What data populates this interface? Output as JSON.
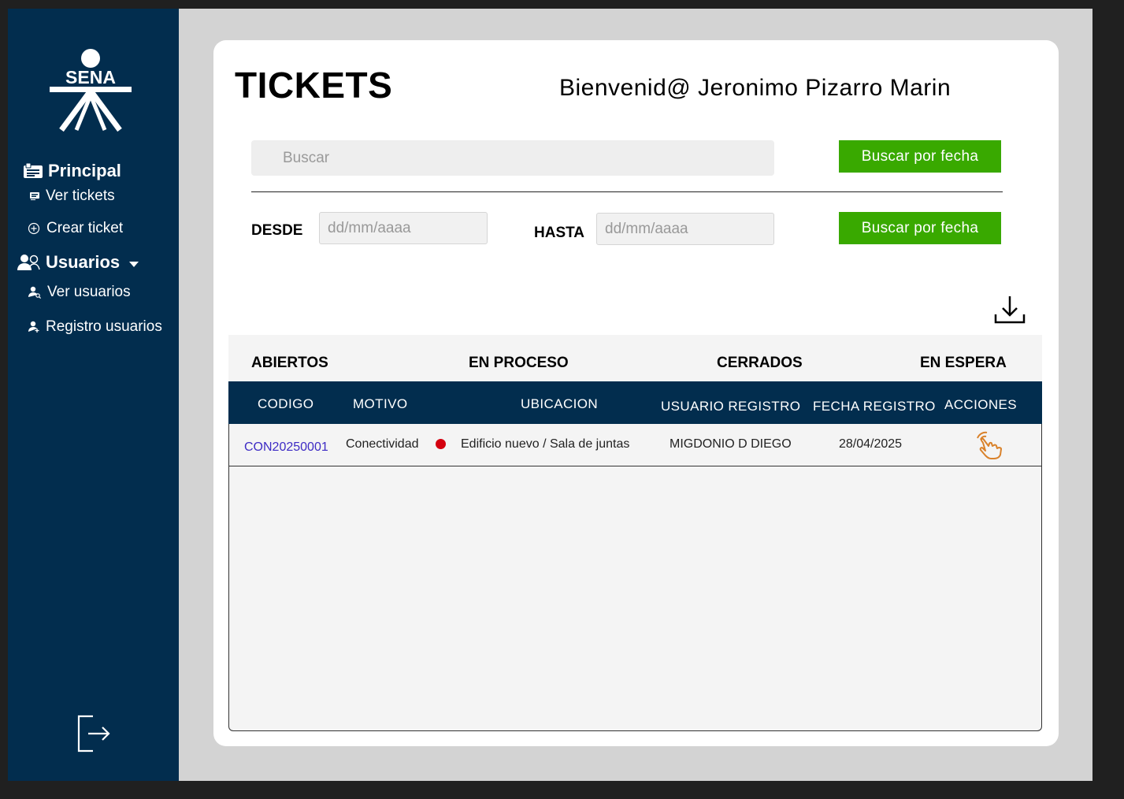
{
  "sidebar": {
    "logo_text": "SENA",
    "section_principal": "Principal",
    "item_ver_tickets": "Ver tickets",
    "item_crear_ticket": "Crear ticket",
    "section_usuarios": "Usuarios",
    "item_ver_usuarios": "Ver usuarios",
    "item_registro_usuarios": "Registro usuarios"
  },
  "header": {
    "title": "TICKETS",
    "welcome": "Bienvenid@ Jeronimo Pizarro Marin"
  },
  "search": {
    "placeholder": "Buscar",
    "button_label": "Buscar por fecha"
  },
  "date_filter": {
    "from_label": "DESDE",
    "from_placeholder": "dd/mm/aaaa",
    "to_label": "HASTA",
    "to_placeholder": "dd/mm/aaaa",
    "button_label": "Buscar por fecha"
  },
  "status_tabs": [
    "ABIERTOS",
    "EN PROCESO",
    "CERRADOS",
    "EN ESPERA"
  ],
  "table": {
    "columns": [
      "CODIGO",
      "MOTIVO",
      "UBICACION",
      "USUARIO REGISTRO",
      "FECHA REGISTRO",
      "ACCIONES"
    ],
    "rows": [
      {
        "codigo": "CON20250001",
        "motivo": "Conectividad",
        "ubicacion": "Edificio nuevo / Sala de juntas",
        "usuario": "MIGDONIO D DIEGO",
        "fecha": "28/04/2025",
        "status_color": "#d4000f",
        "action_icon": "hand-pointer-icon"
      }
    ]
  },
  "colors": {
    "sidebar_bg": "#022d4e",
    "accent_green": "#39a900",
    "table_header_bg": "#022d4e",
    "code_link": "#3d2bc4",
    "action_icon": "#d9822b"
  }
}
